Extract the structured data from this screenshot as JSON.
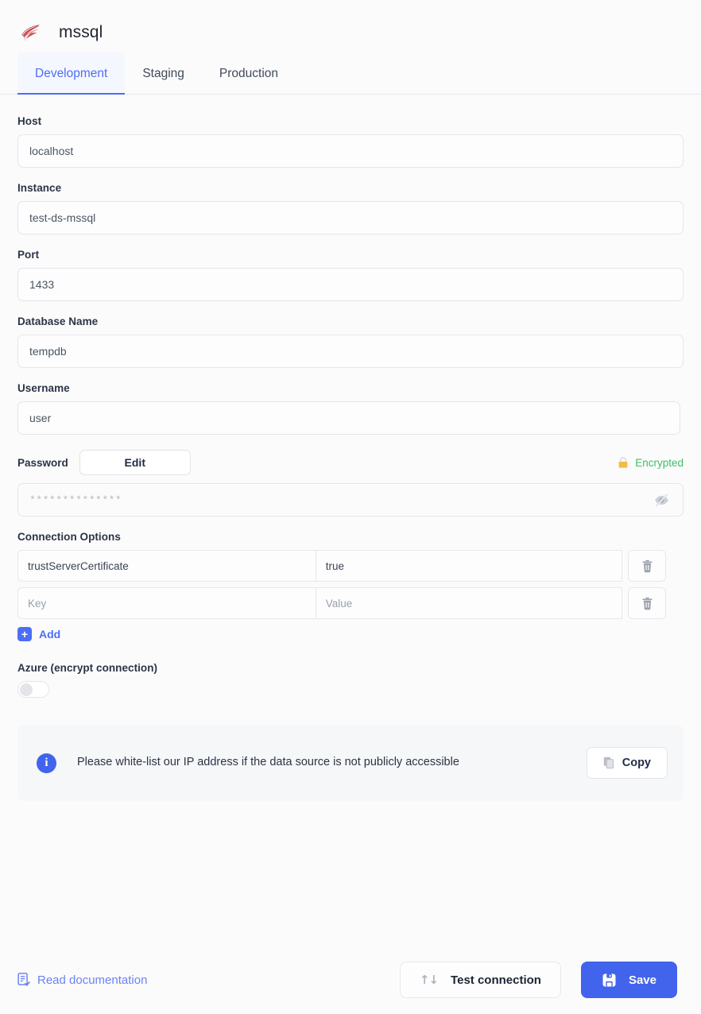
{
  "header": {
    "logo_icon": "mssql-logo-icon",
    "title": "mssql"
  },
  "tabs": [
    {
      "label": "Development",
      "active": true
    },
    {
      "label": "Staging",
      "active": false
    },
    {
      "label": "Production",
      "active": false
    }
  ],
  "form": {
    "host": {
      "label": "Host",
      "value": "localhost"
    },
    "instance": {
      "label": "Instance",
      "value": "test-ds-mssql"
    },
    "port": {
      "label": "Port",
      "value": "1433"
    },
    "database": {
      "label": "Database Name",
      "value": "tempdb"
    },
    "username": {
      "label": "Username",
      "value": "user"
    },
    "password": {
      "label": "Password",
      "edit_label": "Edit",
      "masked_value": "**************",
      "encrypted_label": "Encrypted",
      "lock_icon": "lock-icon",
      "reveal_icon": "eye-off-icon",
      "encrypted_color": "#3fbf63",
      "lock_color": "#f2bd42"
    },
    "connection_options": {
      "label": "Connection Options",
      "columns": [
        "Key",
        "Value"
      ],
      "rows": [
        {
          "key": "trustServerCertificate",
          "value": "true",
          "is_placeholder": false
        },
        {
          "key": "Key",
          "value": "Value",
          "is_placeholder": true
        }
      ],
      "delete_icon": "trash-icon",
      "add_label": "Add",
      "add_icon": "plus-square-icon"
    },
    "azure": {
      "label": "Azure (encrypt connection)",
      "enabled": false
    }
  },
  "banner": {
    "info_icon": "info-circle-icon",
    "message": "Please white-list our IP address if the data source is not publicly accessible",
    "copy_label": "Copy",
    "copy_icon": "copy-icon"
  },
  "footer": {
    "doc_link_label": "Read documentation",
    "doc_link_icon": "document-check-icon",
    "test_label": "Test connection",
    "test_icon": "sort-arrows-icon",
    "save_label": "Save",
    "save_icon": "save-disk-icon"
  },
  "colors": {
    "accent_blue": "#4c6ef5",
    "save_blue": "#4263eb",
    "link_blue": "#6c83f2",
    "green": "#3fbf63",
    "gold": "#f2bd42",
    "page_bg": "#fbfbfc"
  }
}
